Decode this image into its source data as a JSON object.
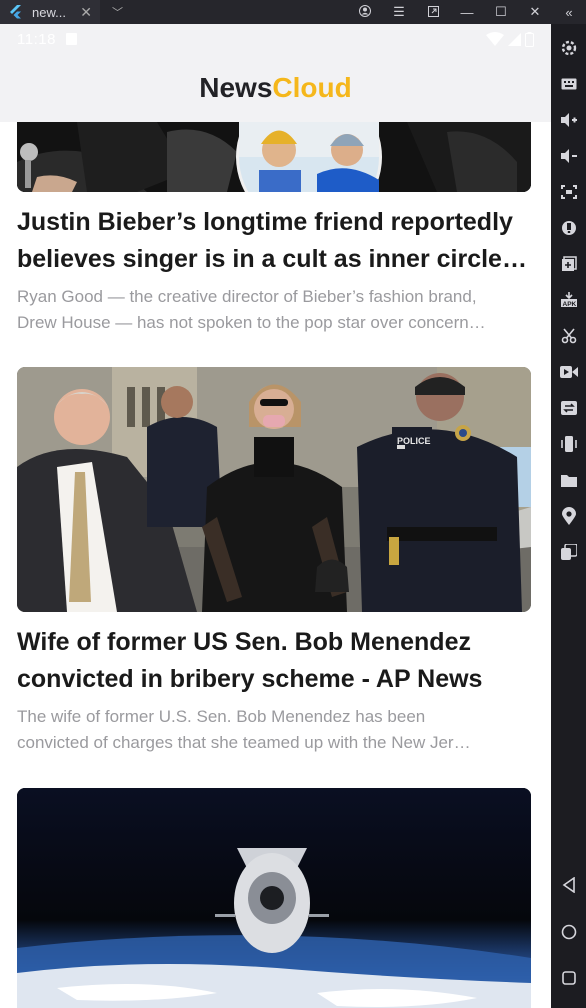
{
  "window": {
    "tab_title": "new...",
    "controls": [
      "account-icon",
      "menu-icon",
      "popout-icon",
      "minimize-icon",
      "maximize-icon",
      "close-icon",
      "collapse-icon"
    ]
  },
  "status_bar": {
    "time": "11:18"
  },
  "app": {
    "logo_part1": "News",
    "logo_part2": "Cloud",
    "accent": "#f5b71b"
  },
  "articles": [
    {
      "title": "Justin Bieber’s longtime friend reportedly believes singer is in a cult as inner circle …",
      "desc_line1": "Ryan Good — the creative director of Bieber’s fashion brand,",
      "desc_line2": "Drew House — has not spoken to the pop star over concern…"
    },
    {
      "title": "Wife of former US Sen. Bob Menendez convicted in bribery scheme - AP News",
      "desc_line1": "The wife of former U.S. Sen. Bob Menendez has been",
      "desc_line2": "convicted of charges that she teamed up with the New Jer…"
    },
    {
      "title": "",
      "desc_line1": "",
      "desc_line2": ""
    }
  ],
  "sidebar_tools": [
    "settings-icon",
    "keyboard-icon",
    "volume-up-icon",
    "volume-down-icon",
    "screenshot-icon",
    "shake-icon",
    "add-window-icon",
    "apk-icon",
    "scissors-icon",
    "record-icon",
    "sync-icon",
    "rotate-icon",
    "folder-icon",
    "location-icon",
    "multi-instance-icon"
  ]
}
